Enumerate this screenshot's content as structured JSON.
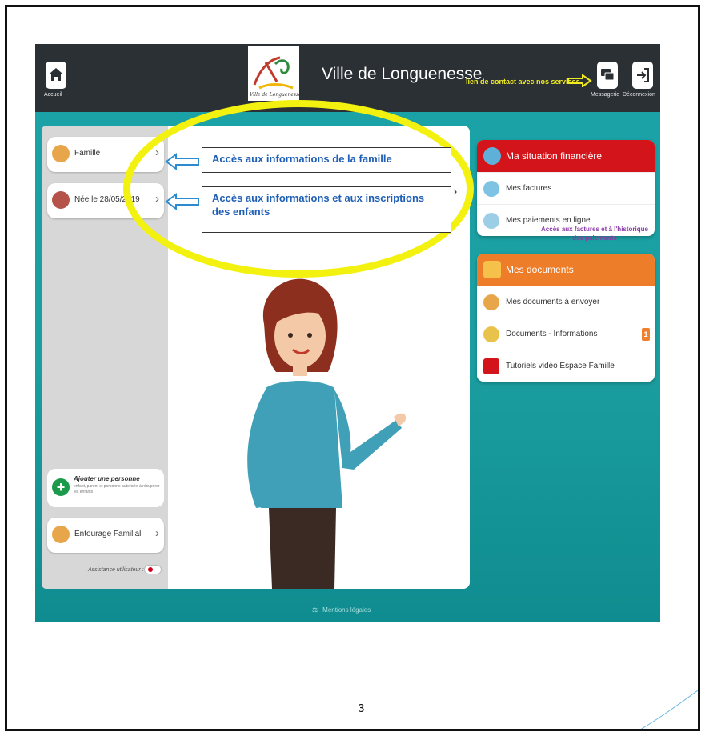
{
  "header": {
    "home_label": "Accueil",
    "city_name": "Ville de Longuenesse",
    "logo_text": "Ville de Longuenesse",
    "contact_note": "lien de contact avec nos services",
    "messaging_label": "Messagerie",
    "logout_label": "Déconnexion"
  },
  "sidebar": {
    "items": [
      {
        "label": "Famille",
        "icon": "family-avatar-icon"
      },
      {
        "label": "Née le 28/05/2019",
        "icon": "child-avatar-icon"
      }
    ],
    "add_person": {
      "title": "Ajouter une personne",
      "description": "enfant, parent et personne autorisée à récupérer les enfants"
    },
    "entourage": {
      "label": "Entourage Familial"
    },
    "assistance_label": "Assistance utilisateur :"
  },
  "annotations": {
    "famille_info": "Accès aux informations de la famille",
    "enfants_info": "Accès aux informations et aux inscriptions des enfants",
    "factures_note": "Accès aux factures et à l'historique des paiements"
  },
  "finance_card": {
    "title": "Ma situation financière",
    "rows": [
      {
        "label": "Mes factures"
      },
      {
        "label": "Mes paiements en ligne"
      }
    ],
    "color": "#d4141b"
  },
  "documents_card": {
    "title": "Mes documents",
    "rows": [
      {
        "label": "Mes documents à envoyer"
      },
      {
        "label": "Documents - Informations",
        "badge": "1"
      },
      {
        "label": "Tutoriels vidéo Espace Famille"
      }
    ],
    "color": "#ee7d2a"
  },
  "footer": {
    "link": "Mentions légales"
  },
  "page_number": "3",
  "colors": {
    "teal_background": "#1aa3a8",
    "header_dark": "#2b3034",
    "highlight_yellow": "#f3f10f",
    "annotation_blue": "#1f5fb5"
  }
}
